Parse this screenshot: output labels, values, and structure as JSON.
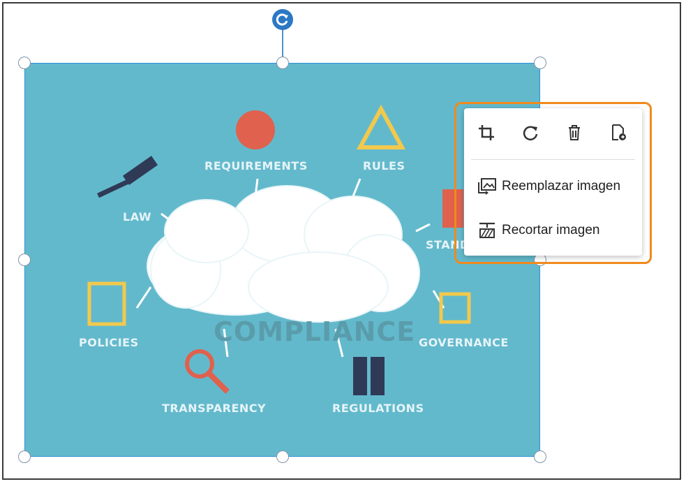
{
  "image": {
    "center_label": "COMPLIANCE",
    "labels": {
      "requirements": "REQUIREMENTS",
      "rules": "RULES",
      "law": "LAW",
      "standards": "STAND",
      "policies": "POLICIES",
      "governance": "GOVERNANCE",
      "transparency": "TRANSPARENCY",
      "regulations": "REGULATIONS"
    }
  },
  "context_menu": {
    "icons": [
      "crop-icon",
      "rotate-icon",
      "trash-icon",
      "export-pdf-icon"
    ],
    "items": [
      {
        "label": "Reemplazar imagen",
        "icon": "replace-image-icon"
      },
      {
        "label": "Recortar imagen",
        "icon": "crop-image-icon"
      }
    ]
  },
  "colors": {
    "selection": "#2f8fd6",
    "menu_outline": "#f08a1c",
    "image_bg": "#63b9cc"
  }
}
